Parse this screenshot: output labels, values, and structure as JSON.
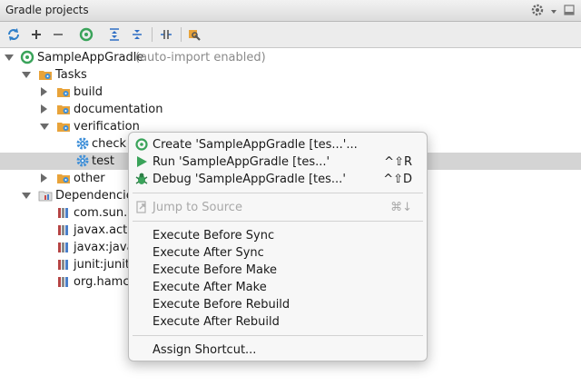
{
  "window": {
    "title": "Gradle projects"
  },
  "toolbar": {
    "buttons": [
      "refresh-icon",
      "add-icon",
      "remove-icon",
      "gradle-execute-icon",
      "expand-all-icon",
      "collapse-all-icon",
      "toggle-offline-icon",
      "settings-wrench-icon"
    ]
  },
  "tree": {
    "root": {
      "label": "SampleAppGradle",
      "note": "(auto-import enabled)"
    },
    "tasks": {
      "label": "Tasks",
      "groups": [
        {
          "label": "build"
        },
        {
          "label": "documentation"
        },
        {
          "label": "verification",
          "children": [
            {
              "label": "check"
            },
            {
              "label": "test"
            }
          ]
        },
        {
          "label": "other"
        }
      ]
    },
    "dependencies": {
      "label": "Dependencies",
      "items": [
        {
          "label": "com.sun.m"
        },
        {
          "label": "javax.activ"
        },
        {
          "label": "javax:java"
        },
        {
          "label": "junit:junit:"
        },
        {
          "label": "org.hamcr"
        }
      ]
    }
  },
  "context_menu": {
    "create": "Create 'SampleAppGradle [tes...'...",
    "run": "Run 'SampleAppGradle [tes...'",
    "run_shortcut": "^⇧R",
    "debug": "Debug 'SampleAppGradle [tes...'",
    "debug_shortcut": "^⇧D",
    "jump": "Jump to Source",
    "jump_shortcut": "⌘↓",
    "before_sync": "Execute Before Sync",
    "after_sync": "Execute After Sync",
    "before_make": "Execute Before Make",
    "after_make": "Execute After Make",
    "before_rebuild": "Execute Before Rebuild",
    "after_rebuild": "Execute After Rebuild",
    "assign_shortcut": "Assign Shortcut..."
  },
  "colors": {
    "selection": "#d4d4d4",
    "gradle_green": "#3aa35a",
    "task_blue": "#3e8fd8",
    "folder_orange": "#e8a33a"
  }
}
